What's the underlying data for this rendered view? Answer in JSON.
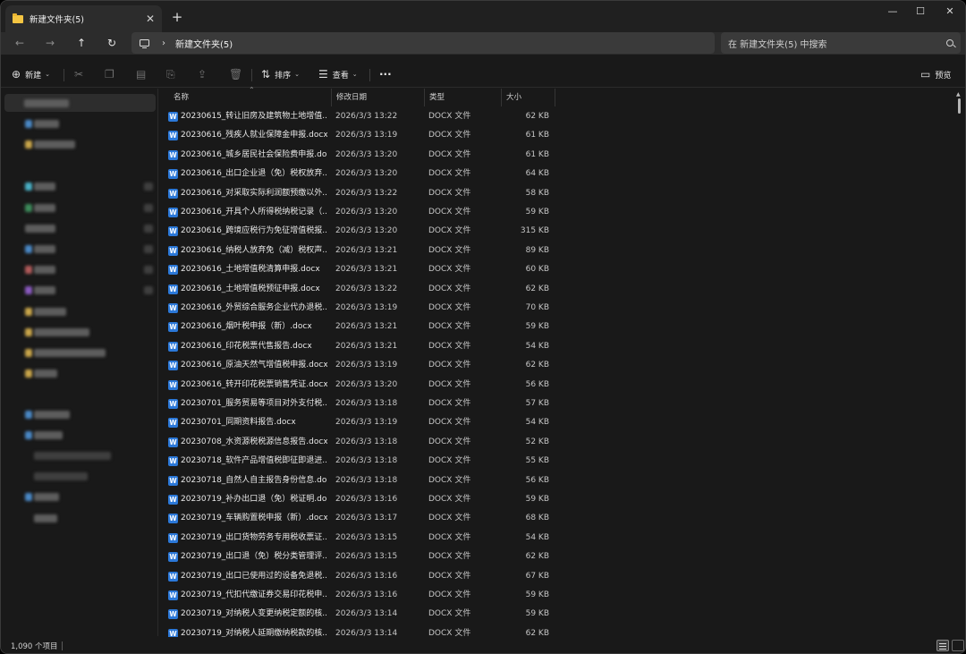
{
  "tab": {
    "title": "新建文件夹(5)",
    "close": "✕"
  },
  "new_tab": "+",
  "window_controls": {
    "minimize": "—",
    "maximize": "☐",
    "close": "✕"
  },
  "nav": {
    "back": "←",
    "forward": "→",
    "up": "↑",
    "refresh": "↻"
  },
  "address": {
    "separator": "›",
    "path": "新建文件夹(5)"
  },
  "search": {
    "placeholder": "在 新建文件夹(5) 中搜索"
  },
  "toolbar": {
    "new_label": "新建",
    "sort_label": "排序",
    "view_label": "查看",
    "more_label": "···",
    "preview_label": "预览"
  },
  "columns": {
    "name": "名称",
    "date": "修改日期",
    "type": "类型",
    "size": "大小"
  },
  "files": [
    {
      "name": "20230615_转让旧房及建筑物土地增值...",
      "date": "2026/3/3 13:22",
      "type": "DOCX 文件",
      "size": "62 KB"
    },
    {
      "name": "20230616_残疾人就业保障金申报.docx",
      "date": "2026/3/3 13:19",
      "type": "DOCX 文件",
      "size": "61 KB"
    },
    {
      "name": "20230616_城乡居民社会保险费申报.do...",
      "date": "2026/3/3 13:20",
      "type": "DOCX 文件",
      "size": "61 KB"
    },
    {
      "name": "20230616_出口企业退（免）税权放弃...",
      "date": "2026/3/3 13:20",
      "type": "DOCX 文件",
      "size": "64 KB"
    },
    {
      "name": "20230616_对采取实际利润额预缴以外...",
      "date": "2026/3/3 13:22",
      "type": "DOCX 文件",
      "size": "58 KB"
    },
    {
      "name": "20230616_开具个人所得税纳税记录（...",
      "date": "2026/3/3 13:20",
      "type": "DOCX 文件",
      "size": "59 KB"
    },
    {
      "name": "20230616_跨境应税行为免征增值税报...",
      "date": "2026/3/3 13:20",
      "type": "DOCX 文件",
      "size": "315 KB"
    },
    {
      "name": "20230616_纳税人放弃免（减）税权声...",
      "date": "2026/3/3 13:21",
      "type": "DOCX 文件",
      "size": "89 KB"
    },
    {
      "name": "20230616_土地增值税清算申报.docx",
      "date": "2026/3/3 13:21",
      "type": "DOCX 文件",
      "size": "60 KB"
    },
    {
      "name": "20230616_土地增值税预征申报.docx",
      "date": "2026/3/3 13:22",
      "type": "DOCX 文件",
      "size": "62 KB"
    },
    {
      "name": "20230616_外贸综合服务企业代办退税...",
      "date": "2026/3/3 13:19",
      "type": "DOCX 文件",
      "size": "70 KB"
    },
    {
      "name": "20230616_烟叶税申报（新）.docx",
      "date": "2026/3/3 13:21",
      "type": "DOCX 文件",
      "size": "59 KB"
    },
    {
      "name": "20230616_印花税票代售报告.docx",
      "date": "2026/3/3 13:21",
      "type": "DOCX 文件",
      "size": "54 KB"
    },
    {
      "name": "20230616_原油天然气增值税申报.docx",
      "date": "2026/3/3 13:19",
      "type": "DOCX 文件",
      "size": "62 KB"
    },
    {
      "name": "20230616_转开印花税票销售凭证.docx",
      "date": "2026/3/3 13:20",
      "type": "DOCX 文件",
      "size": "56 KB"
    },
    {
      "name": "20230701_服务贸易等项目对外支付税...",
      "date": "2026/3/3 13:18",
      "type": "DOCX 文件",
      "size": "57 KB"
    },
    {
      "name": "20230701_同期资料报告.docx",
      "date": "2026/3/3 13:19",
      "type": "DOCX 文件",
      "size": "54 KB"
    },
    {
      "name": "20230708_水资源税税源信息报告.docx",
      "date": "2026/3/3 13:18",
      "type": "DOCX 文件",
      "size": "52 KB"
    },
    {
      "name": "20230718_软件产品增值税即征即退进...",
      "date": "2026/3/3 13:18",
      "type": "DOCX 文件",
      "size": "55 KB"
    },
    {
      "name": "20230718_自然人自主报告身份信息.do...",
      "date": "2026/3/3 13:18",
      "type": "DOCX 文件",
      "size": "56 KB"
    },
    {
      "name": "20230719_补办出口退（免）税证明.do...",
      "date": "2026/3/3 13:16",
      "type": "DOCX 文件",
      "size": "59 KB"
    },
    {
      "name": "20230719_车辆购置税申报（新）.docx",
      "date": "2026/3/3 13:17",
      "type": "DOCX 文件",
      "size": "68 KB"
    },
    {
      "name": "20230719_出口货物劳务专用税收票证...",
      "date": "2026/3/3 13:15",
      "type": "DOCX 文件",
      "size": "54 KB"
    },
    {
      "name": "20230719_出口退（免）税分类管理评...",
      "date": "2026/3/3 13:15",
      "type": "DOCX 文件",
      "size": "62 KB"
    },
    {
      "name": "20230719_出口已使用过的设备免退税...",
      "date": "2026/3/3 13:16",
      "type": "DOCX 文件",
      "size": "67 KB"
    },
    {
      "name": "20230719_代扣代缴证券交易印花税申...",
      "date": "2026/3/3 13:16",
      "type": "DOCX 文件",
      "size": "59 KB"
    },
    {
      "name": "20230719_对纳税人变更纳税定额的核...",
      "date": "2026/3/3 13:14",
      "type": "DOCX 文件",
      "size": "59 KB"
    },
    {
      "name": "20230719_对纳税人延期缴纳税款的核...",
      "date": "2026/3/3 13:14",
      "type": "DOCX 文件",
      "size": "62 KB"
    }
  ],
  "status": {
    "item_count": "1,090 个项目"
  },
  "colors": {
    "word_blue": "#2b78d8",
    "folder_yellow": "#f4c542",
    "background": "#191919"
  }
}
